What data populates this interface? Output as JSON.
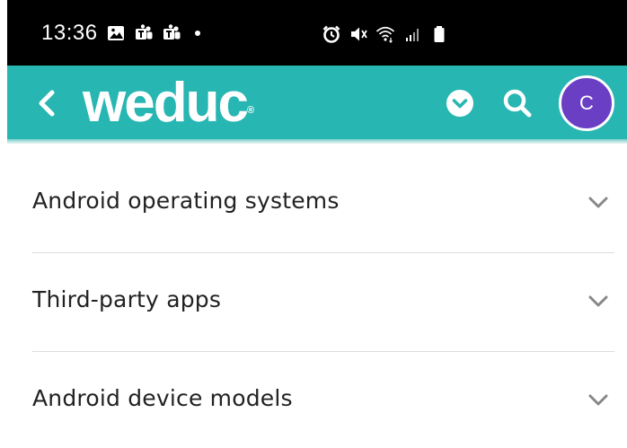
{
  "status_bar": {
    "time": "13:36",
    "left_icons": [
      "image-icon",
      "teams-icon",
      "teams-icon",
      "dot-icon"
    ],
    "right_icons": [
      "alarm-icon",
      "mute-icon",
      "wifi-icon",
      "signal-icon",
      "battery-icon"
    ]
  },
  "app_bar": {
    "logo_text": "weduc",
    "logo_mark": "®",
    "avatar_initial": "C",
    "colors": {
      "bar": "#27b6b2",
      "avatar": "#6a3fc4"
    }
  },
  "sections": [
    {
      "label": "Android operating systems"
    },
    {
      "label": "Third-party apps"
    },
    {
      "label": "Android device models"
    }
  ]
}
